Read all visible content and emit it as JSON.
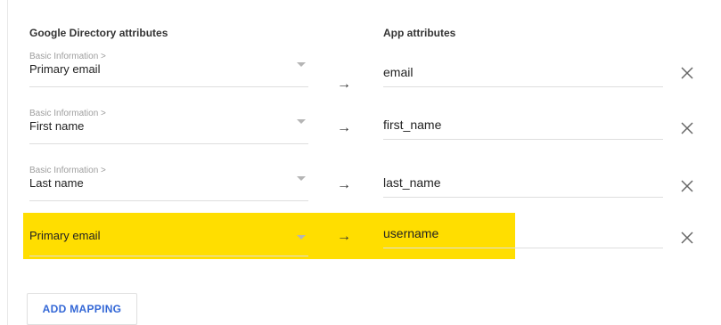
{
  "headers": {
    "google_directory": "Google Directory attributes",
    "app_attributes": "App attributes"
  },
  "mappings": [
    {
      "category": "Basic Information >",
      "attribute": "Primary email",
      "app_value": "email",
      "highlighted": false
    },
    {
      "category": "Basic Information >",
      "attribute": "First name",
      "app_value": "first_name",
      "highlighted": false
    },
    {
      "category": "Basic Information >",
      "attribute": "Last name",
      "app_value": "last_name",
      "highlighted": false
    },
    {
      "category": "",
      "attribute": "Primary email",
      "app_value": "username",
      "highlighted": true
    }
  ],
  "arrow_glyph": "→",
  "remove_glyph": "close-icon",
  "add_mapping_label": "ADD MAPPING",
  "colors": {
    "highlight": "#ffde00",
    "link_blue": "#3367d6",
    "muted_text": "#9e9e9e",
    "divider": "#dedede"
  }
}
